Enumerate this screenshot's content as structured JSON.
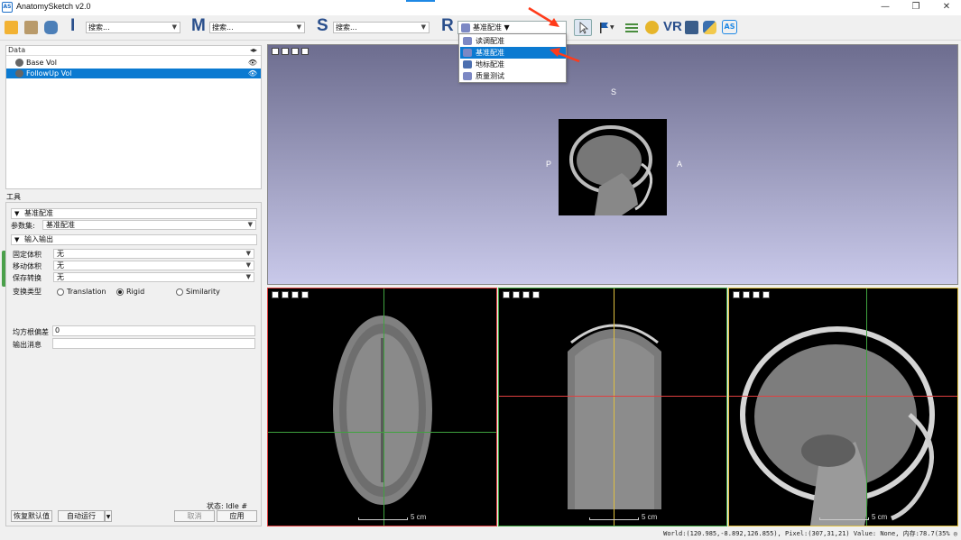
{
  "window": {
    "title": "AnatomySketch v2.0",
    "logo_text": "AS",
    "minimize": "—",
    "maximize": "❐",
    "close": "✕"
  },
  "toolbar": {
    "letters": {
      "i": "I",
      "m": "M",
      "s": "S",
      "r": "R"
    },
    "search_i": "搜索...",
    "search_m": "搜索...",
    "search_s": "搜索...",
    "registration_combo": "基准配准",
    "vr_label": "VR",
    "as_label": "AS",
    "icons": [
      "folder-icon",
      "open-icon",
      "database-icon",
      "cursor-icon",
      "flag-icon",
      "list-icon",
      "pencil-icon",
      "vr-icon",
      "screen-icon",
      "python-icon",
      "as-icon"
    ]
  },
  "dropdown": {
    "items": [
      "读调配准",
      "基准配准",
      "地标配准",
      "质量测试"
    ],
    "selected_index": 1
  },
  "data_panel": {
    "header": "Data",
    "rows": [
      {
        "label": "Base Vol"
      },
      {
        "label": "FollowUp Vol"
      }
    ],
    "selected_index": 1
  },
  "tools": {
    "label": "工具",
    "section1": "基准配准",
    "module_label": "参数集:",
    "module_value": "基准配准",
    "section2": "输入输出",
    "fixed_label": "固定体积",
    "fixed_value": "无",
    "moving_label": "移动体积",
    "moving_value": "无",
    "save_label": "保存转换",
    "save_value": "无",
    "transform_label": "变换类型",
    "radios": [
      "Translation",
      "Rigid",
      "Similarity"
    ],
    "radio_selected": 1,
    "rms_label": "均方根偏差",
    "rms_value": "0",
    "output_label": "输出消息",
    "output_value": "",
    "status_label": "状态: Idle #",
    "btn_reset": "恢复默认值",
    "btn_auto": "自动运行",
    "btn_cancel": "取消",
    "btn_apply": "应用"
  },
  "view3d": {
    "orient_s": "S",
    "orient_p": "P",
    "orient_a": "A"
  },
  "slices": {
    "scale_label": "5 cm"
  },
  "statusbar": {
    "text": "World:(120.985,-8.892,126.855), Pixel:(307,31,21) Value: None, 内存:78.7(35% ◎"
  }
}
